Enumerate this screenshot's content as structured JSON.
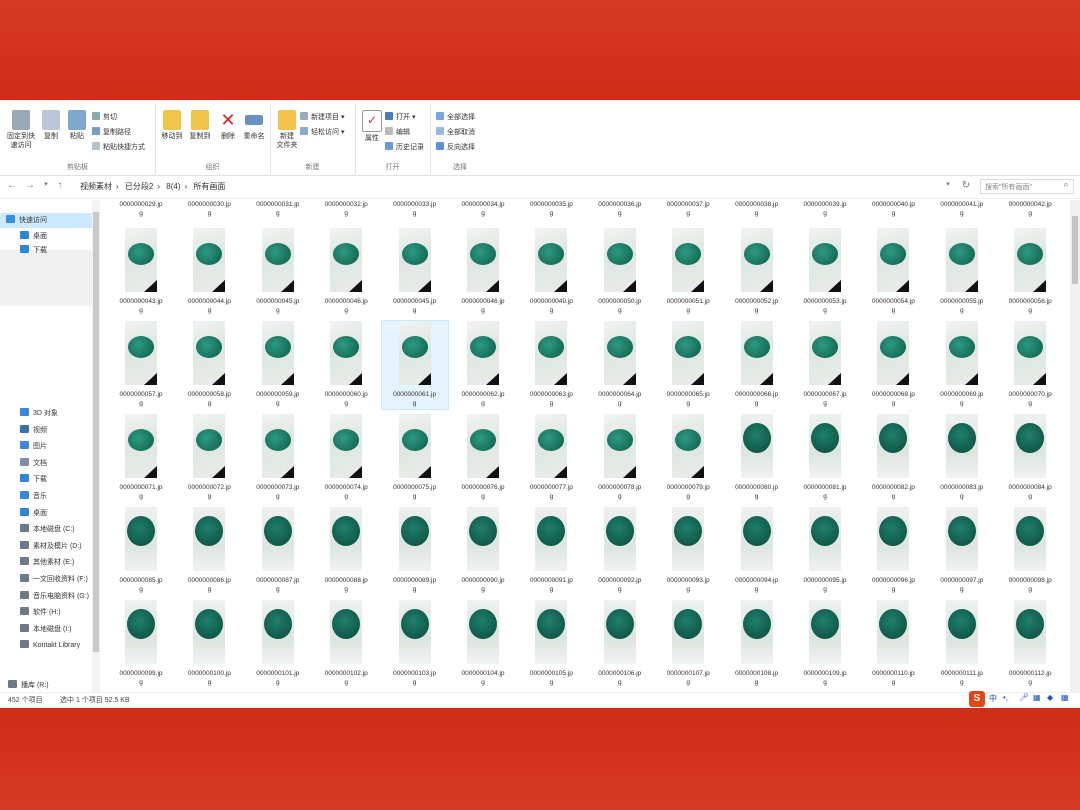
{
  "ribbon": {
    "clipboard": {
      "pin_label": "固定到快速访问",
      "copy_label": "复制",
      "paste_label": "粘贴",
      "cut_label": "剪切",
      "copy_path_label": "复制路径",
      "paste_shortcut_label": "粘贴快捷方式",
      "group_label": "剪贴板"
    },
    "organize": {
      "move_to_label": "移动到",
      "copy_to_label": "复制到",
      "delete_label": "删除",
      "rename_label": "重命名",
      "group_label": "组织"
    },
    "new": {
      "new_folder_label": "新建\n文件夹",
      "new_item_label": "新建项目",
      "easy_access_label": "轻松访问",
      "group_label": "新建"
    },
    "open": {
      "properties_label": "属性",
      "open_label": "打开",
      "edit_label": "编辑",
      "history_label": "历史记录",
      "group_label": "打开"
    },
    "select": {
      "select_all_label": "全部选择",
      "select_none_label": "全部取消",
      "invert_label": "反向选择",
      "group_label": "选择"
    }
  },
  "address": {
    "path": [
      "视频素材",
      "已分段2",
      "8(4)",
      "所有画面"
    ],
    "search_placeholder": "搜索\"所有画面\""
  },
  "nav": {
    "quick_access": "快速访问",
    "items_top": [
      "桌面",
      "下载"
    ],
    "items": [
      "3D 对象",
      "视频",
      "图片",
      "文档",
      "下载",
      "音乐",
      "桌面",
      "本地磁盘 (C:)",
      "素材及模片 (D:)",
      "其他素材 (E:)",
      "一文回收资料 (F:)",
      "音乐电脑资料 (G:)",
      "软件 (H:)",
      "本地磁盘 (I:)",
      "Kontakt Library",
      "播库 (R:)"
    ],
    "bottom_item": "播库 (R:)"
  },
  "grid": {
    "top_row": [
      "0000000029.jp\ng",
      "0000000030.jp\ng",
      "0000000031.jp\ng",
      "0000000032.jp\ng",
      "0000000033.jp\ng",
      "0000000034.jp\ng",
      "0000000035.jp\ng",
      "0000000036.jp\ng",
      "0000000037.jp\ng",
      "0000000038.jp\ng",
      "0000000039.jp\ng",
      "0000000040.jp\ng",
      "0000000041.jp\ng",
      "0000000042.jp\ng"
    ],
    "rows": [
      [
        "0000000043.jp\ng",
        "0000000044.jp\ng",
        "0000000045.jp\ng",
        "0000000046.jp\ng",
        "0000000045.jp\ng",
        "0000000046.jp\ng",
        "0000000049.jp\ng",
        "0000000050.jp\ng",
        "0000000051.jp\ng",
        "0000000052.jp\ng",
        "0000000053.jp\ng",
        "0000000054.jp\ng",
        "0000000055.jp\ng",
        "0000000056.jp\ng"
      ],
      [
        "0000000057.jp\ng",
        "0000000058.jp\ng",
        "0000000059.jp\ng",
        "0000000060.jp\ng",
        "0000000061.jp\ng",
        "0000000062.jp\ng",
        "0000000063.jp\ng",
        "0000000064.jp\ng",
        "0000000065.jp\ng",
        "0000000066.jp\ng",
        "0000000067.jp\ng",
        "0000000068.jp\ng",
        "0000000069.jp\ng",
        "0000000070.jp\ng"
      ],
      [
        "0000000071.jp\ng",
        "0000000072.jp\ng",
        "0000000073.jp\ng",
        "0000000074.jp\ng",
        "0000000075.jp\ng",
        "0000000076.jp\ng",
        "0000000077.jp\ng",
        "0000000078.jp\ng",
        "0000000079.jp\ng",
        "0000000080.jp\ng",
        "0000000081.jp\ng",
        "0000000082.jp\ng",
        "0000000083.jp\ng",
        "0000000084.jp\ng"
      ],
      [
        "0000000085.jp\ng",
        "0000000086.jp\ng",
        "0000000087.jp\ng",
        "0000000088.jp\ng",
        "0000000089.jp\ng",
        "0000000090.jp\ng",
        "0000000091.jp\ng",
        "0000000092.jp\ng",
        "0000000093.jp\ng",
        "0000000094.jp\ng",
        "0000000095.jp\ng",
        "0000000096.jp\ng",
        "0000000097.jp\ng",
        "0000000098.jp\ng"
      ],
      [
        "0000000099.jp\ng",
        "0000000100.jp\ng",
        "0000000101.jp\ng",
        "0000000102.jp\ng",
        "0000000103.jp\ng",
        "0000000104.jp\ng",
        "0000000105.jp\ng",
        "0000000106.jp\ng",
        "0000000107.jp\ng",
        "0000000108.jp\ng",
        "0000000109.jp\ng",
        "0000000110.jp\ng",
        "0000000111.jp\ng",
        "0000000112.jp\ng"
      ]
    ],
    "selected": {
      "row": 1,
      "col": 4
    }
  },
  "status": {
    "count": "452 个项目",
    "selection": "选中 1 个项目  92.5 KB"
  },
  "tray": {
    "logo": "S",
    "ime_label": "中"
  },
  "colors": {
    "background": "#d8321f",
    "selection": "#cde8ff",
    "bowl": "#1f7f6b"
  }
}
